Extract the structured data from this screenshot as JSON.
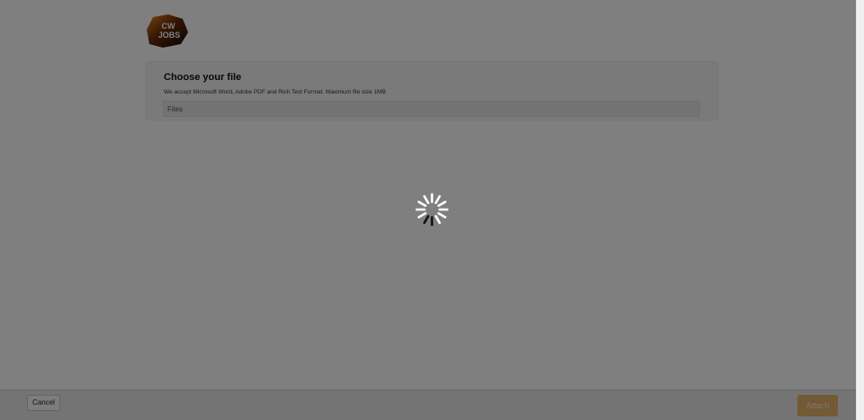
{
  "logo": {
    "text_line1": "CW",
    "text_line2": "JOBS"
  },
  "file_section": {
    "title": "Choose your file",
    "description": "We accept Microsoft Word, Adobe PDF and Rich Text Format. Maximum file size 1MB",
    "files_label": "Files"
  },
  "footer": {
    "cancel_label": "Cancel",
    "attach_label": "Attach"
  },
  "colors": {
    "attach_button": "#e7b36a",
    "overlay": "rgba(0,0,0,0.5)"
  },
  "loading": {
    "icon": "spinner-icon"
  }
}
